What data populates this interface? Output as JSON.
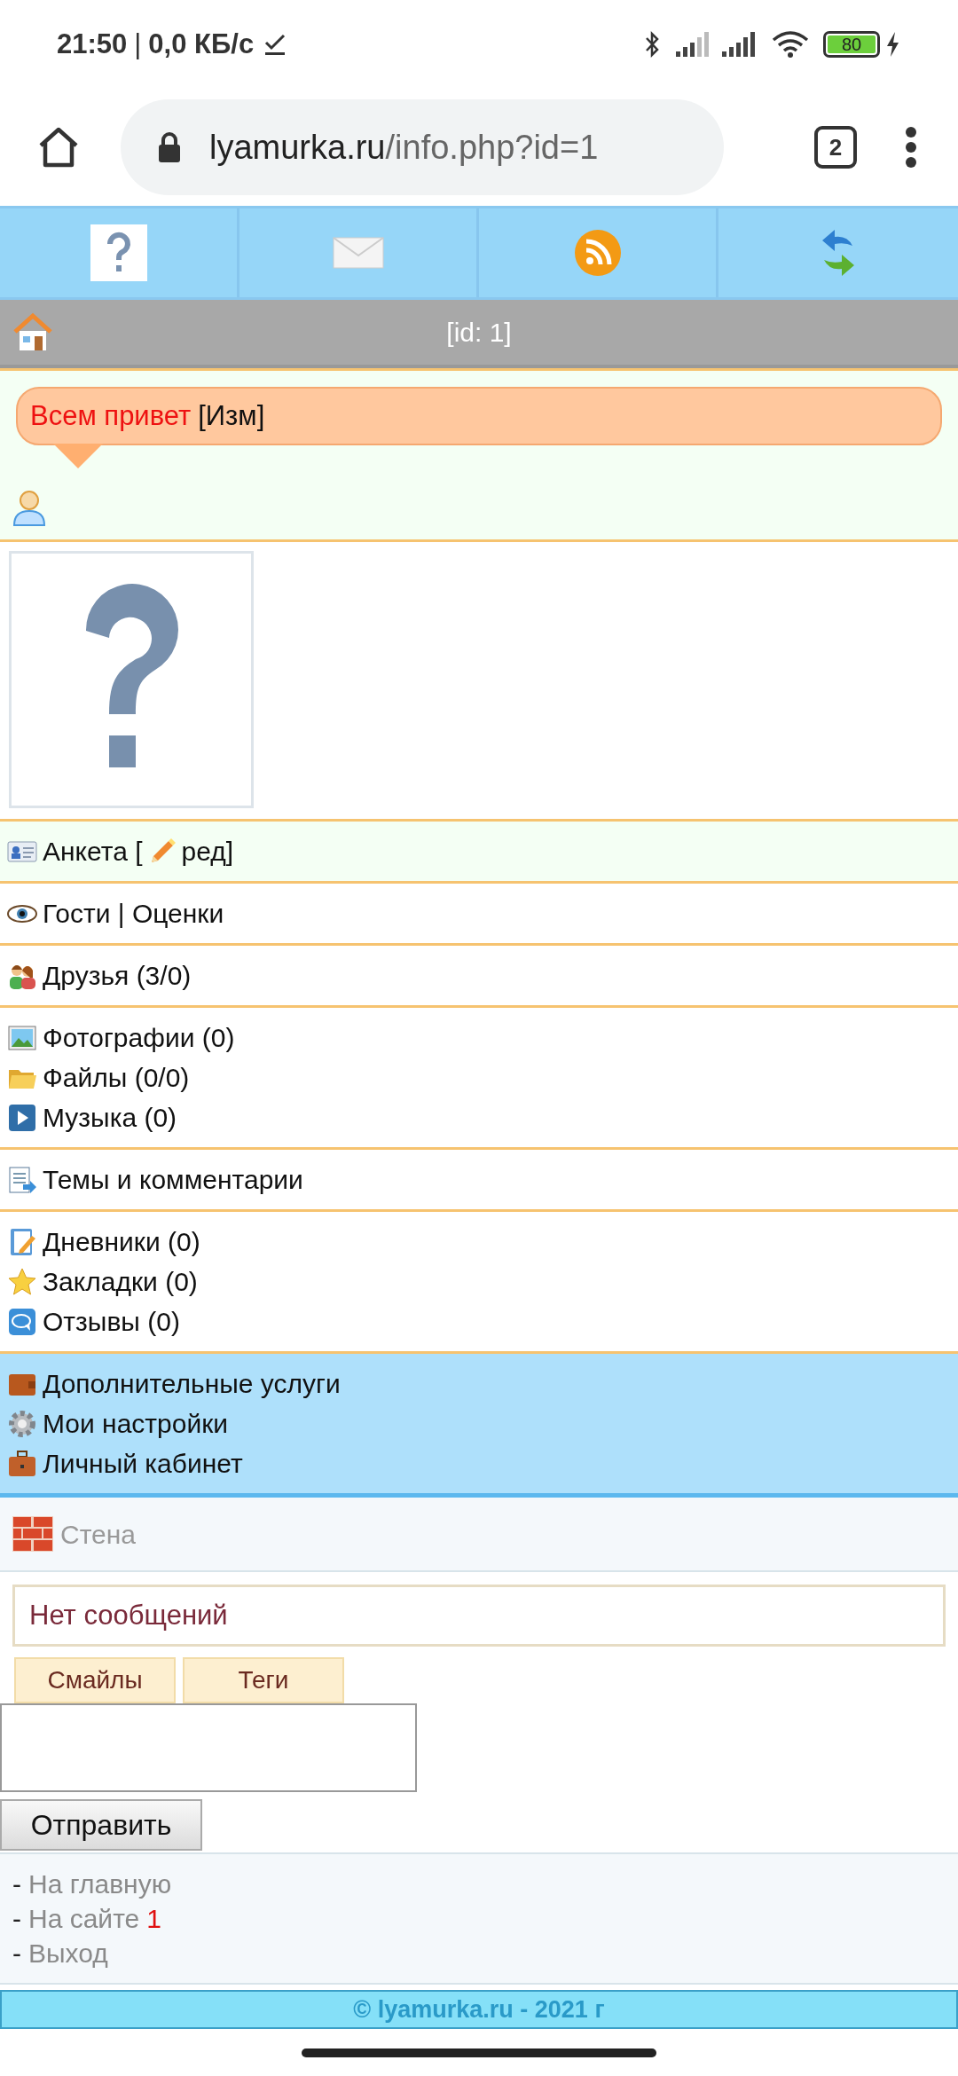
{
  "status_bar": {
    "time": "21:50",
    "separator": "|",
    "speed": "0,0 КБ/с",
    "battery": "80"
  },
  "browser": {
    "url_host": "lyamurka.ru",
    "url_path": "/info.php?id=1",
    "tab_count": "2"
  },
  "header": {
    "title": "[id: 1]"
  },
  "status_message": {
    "text": "Всем привет",
    "edit": "[Изм]"
  },
  "menu_groups": [
    {
      "kind": "profile",
      "items": [
        {
          "label": "Анкета [",
          "suffix": "ред]"
        }
      ]
    },
    {
      "kind": "plain",
      "items": [
        {
          "label": "Гости | Оценки"
        }
      ]
    },
    {
      "kind": "plain",
      "items": [
        {
          "label": "Друзья (3/0)"
        }
      ]
    },
    {
      "kind": "plain",
      "items": [
        {
          "label": "Фотографии (0)"
        },
        {
          "label": "Файлы (0/0)"
        },
        {
          "label": "Музыка (0)"
        }
      ]
    },
    {
      "kind": "plain",
      "items": [
        {
          "label": "Темы и комментарии"
        }
      ]
    },
    {
      "kind": "plain",
      "items": [
        {
          "label": "Дневники (0)"
        },
        {
          "label": "Закладки (0)"
        },
        {
          "label": "Отзывы (0)"
        }
      ]
    },
    {
      "kind": "highlight",
      "items": [
        {
          "label": "Дополнительные услуги"
        },
        {
          "label": "Мои настройки"
        },
        {
          "label": "Личный кабинет"
        }
      ]
    }
  ],
  "wall": {
    "title": "Стена",
    "empty_text": "Нет сообщений",
    "tool_buttons": [
      "Смайлы",
      "Теги"
    ],
    "send_button": "Отправить"
  },
  "links": [
    {
      "prefix": "-",
      "text": "На главную"
    },
    {
      "prefix": "-",
      "text": "На сайте",
      "count": "1"
    },
    {
      "prefix": "-",
      "text": "Выход"
    }
  ],
  "footer": "© lyamurka.ru - 2021 г"
}
